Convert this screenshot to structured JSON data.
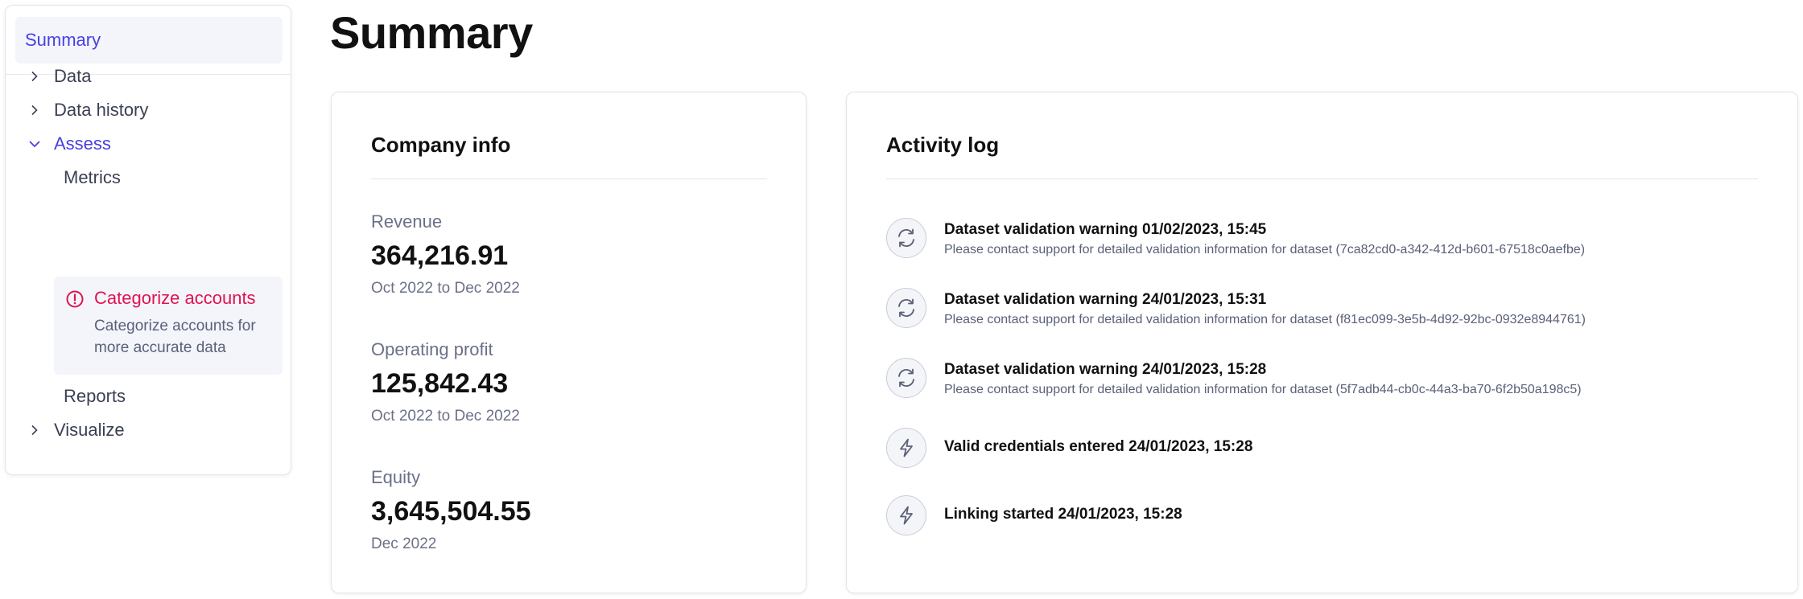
{
  "sidebar": {
    "summary_label": "Summary",
    "items": [
      {
        "label": "Data",
        "icon": "chevron-right-icon"
      },
      {
        "label": "Data history",
        "icon": "chevron-right-icon"
      },
      {
        "label": "Assess",
        "icon": "chevron-down-icon"
      },
      {
        "label": "Visualize",
        "icon": "chevron-right-icon"
      }
    ],
    "assess_children": {
      "metrics": "Metrics",
      "categorize_title": "Categorize accounts",
      "categorize_desc": "Categorize accounts for more accurate data",
      "reports": "Reports"
    },
    "colors": {
      "active": "#4a3fe0",
      "alert": "#e0134e"
    }
  },
  "page": {
    "title": "Summary"
  },
  "company_info": {
    "title": "Company info",
    "metrics": [
      {
        "label": "Revenue",
        "value": "364,216.91",
        "period": "Oct 2022 to Dec 2022"
      },
      {
        "label": "Operating profit",
        "value": "125,842.43",
        "period": "Oct 2022 to Dec 2022"
      },
      {
        "label": "Equity",
        "value": "3,645,504.55",
        "period": "Dec 2022"
      }
    ]
  },
  "activity_log": {
    "title": "Activity log",
    "entries": [
      {
        "icon": "refresh-icon",
        "title": "Dataset validation warning 01/02/2023, 15:45",
        "desc": "Please contact support for detailed validation information for dataset (7ca82cd0-a342-412d-b601-67518c0aefbe)"
      },
      {
        "icon": "refresh-icon",
        "title": "Dataset validation warning 24/01/2023, 15:31",
        "desc": "Please contact support for detailed validation information for dataset (f81ec099-3e5b-4d92-92bc-0932e8944761)"
      },
      {
        "icon": "refresh-icon",
        "title": "Dataset validation warning 24/01/2023, 15:28",
        "desc": "Please contact support for detailed validation information for dataset (5f7adb44-cb0c-44a3-ba70-6f2b50a198c5)"
      },
      {
        "icon": "lightning-icon",
        "title": "Valid credentials entered 24/01/2023, 15:28",
        "desc": ""
      },
      {
        "icon": "lightning-icon",
        "title": "Linking started 24/01/2023, 15:28",
        "desc": ""
      }
    ]
  }
}
